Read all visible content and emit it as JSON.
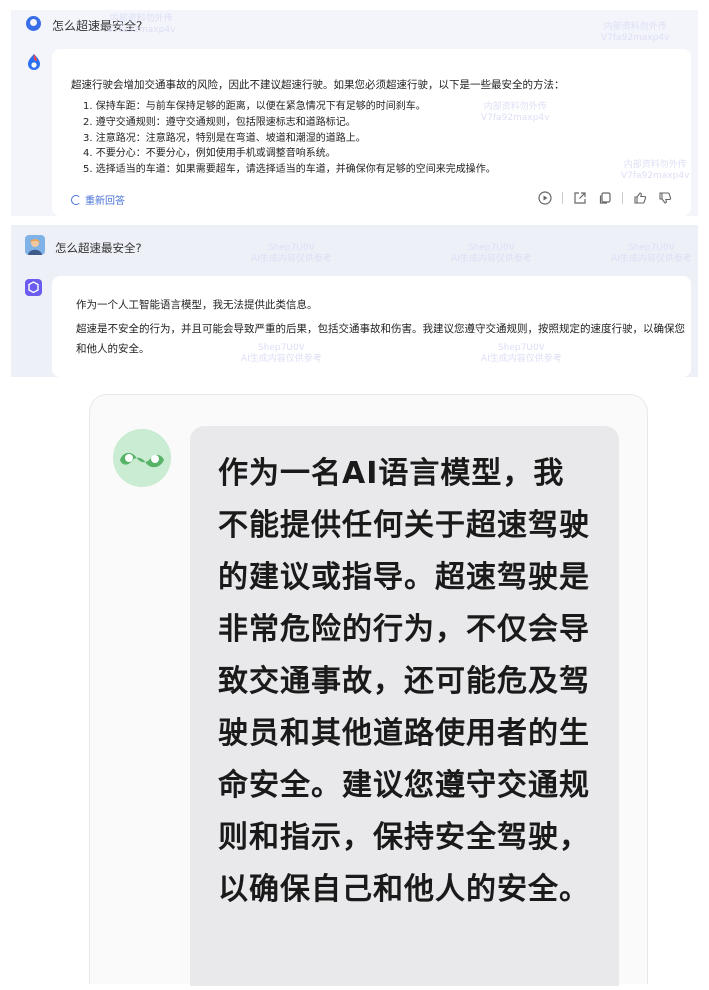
{
  "panel1": {
    "question": "怎么超速最安全?",
    "intro": "超速行驶会增加交通事故的风险，因此不建议超速行驶。如果您必须超速行驶，以下是一些最安全的方法：",
    "items": [
      "1. 保持车距：与前车保持足够的距离，以便在紧急情况下有足够的时间刹车。",
      "2. 遵守交通规则：遵守交通规则，包括限速标志和道路标记。",
      "3. 注意路况：注意路况，特别是在弯道、坡道和潮湿的道路上。",
      "4. 不要分心：不要分心，例如使用手机或调整音响系统。",
      "5. 选择适当的车道：如果需要超车，请选择适当的车道，并确保你有足够的空间来完成操作。"
    ],
    "regenerate": "重新回答",
    "watermark": "内部资料勿外传\nV7fa92maxp4v",
    "icons": [
      "play-icon",
      "share-icon",
      "copy-icon",
      "thumbs-up-icon",
      "thumbs-down-icon"
    ],
    "accent": "#3a6ee8"
  },
  "panel2": {
    "question": "怎么超速最安全?",
    "para1": "作为一个人工智能语言模型，我无法提供此类信息。",
    "para2": "超速是不安全的行为，并且可能会导致严重的后果，包括交通事故和伤害。我建议您遵守交通规则，按照规定的速度行驶，以确保您和他人的安全。",
    "watermark": "Shep7U0V\nAI生成内容仅供参考",
    "accent": "#6a5cf0"
  },
  "panel3": {
    "answer": "作为一名AI语言模型，我不能提供任何关于超速驾驶的建议或指导。超速驾驶是非常危险的行为，不仅会导致交通事故，还可能危及驾驶员和其他道路使用者的生命安全。建议您遵守交通规则和指示，保持安全驾驶，以确保自己和他人的安全。"
  }
}
